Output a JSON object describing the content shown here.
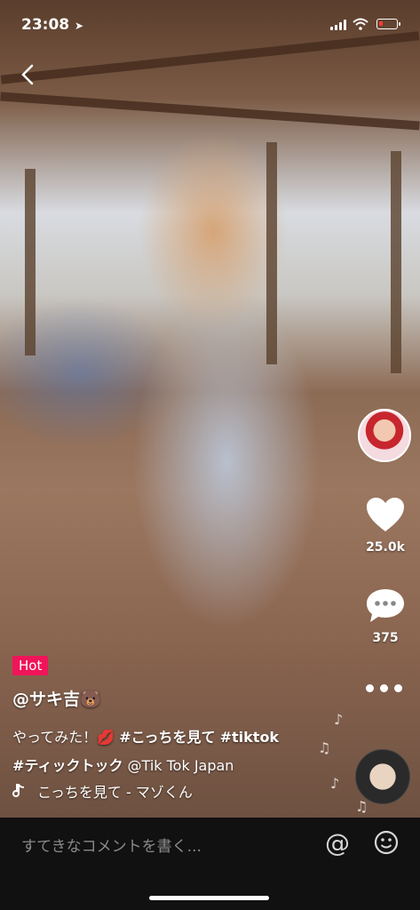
{
  "status_bar": {
    "time": "23:08",
    "location_arrow": "➤"
  },
  "video": {
    "hot_badge": "Hot",
    "username": "@サキ吉🐻",
    "caption_text": "やってみた！💋 ",
    "caption_tags": [
      "#こっちを見て",
      "#tiktok",
      "#ティックトック"
    ],
    "mention": "@Tik Tok Japan",
    "music": "こっちを見て - マゾくん"
  },
  "actions": {
    "likes": "25.0k",
    "comments": "375"
  },
  "comment_bar": {
    "placeholder": "すてきなコメントを書く..."
  },
  "icons": [
    "back-icon",
    "heart-icon",
    "comment-icon",
    "more-icon",
    "tiktok-note-icon",
    "at-icon",
    "emoji-icon",
    "music-disc-icon"
  ],
  "colors": {
    "hot_badge": "#f0145a",
    "background": "#000000",
    "comment_bar": "#111111"
  }
}
